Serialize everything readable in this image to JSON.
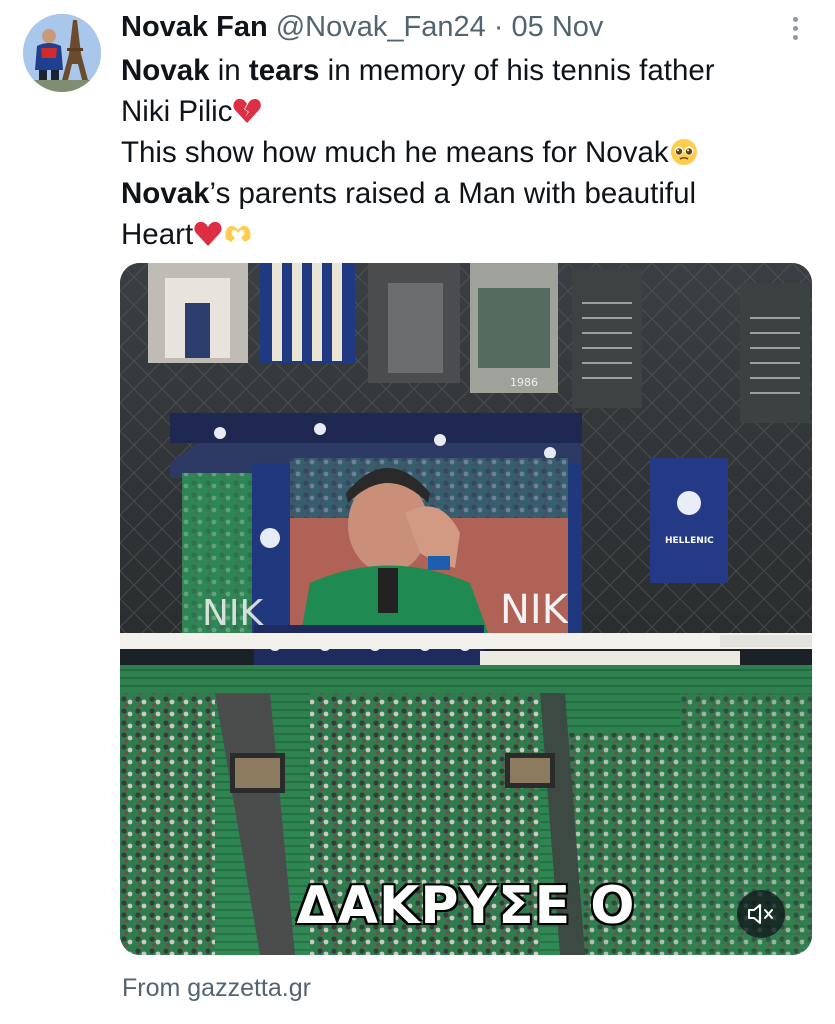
{
  "author": {
    "name": "Novak Fan",
    "handle": "@Novak_Fan24",
    "separator": "·",
    "date": "05 Nov"
  },
  "tweet": {
    "line1_bold1": "Novak",
    "line1_mid": " in ",
    "line1_bold2": "tears",
    "line1_rest": " in memory of his tennis father",
    "line2": "Niki Pilic",
    "line3": "This show how much he means for Novak",
    "line4_bold": "Novak",
    "line4_rest": "’s parents raised a Man with beautiful",
    "line5": "Heart"
  },
  "media": {
    "caption": "ΔΑΚΡΥΣΕ Ο",
    "jumbotron_text_left": "NIK",
    "jumbotron_text_right": "NIK",
    "banner_year": "1986",
    "sponsor": "HELLENIC"
  },
  "icons": {
    "more": "more-options-icon",
    "mute": "muted-speaker-icon",
    "emoji1": "broken-heart-emoji",
    "emoji2": "pleading-face-emoji",
    "emoji3": "red-heart-emoji",
    "emoji4": "heart-hands-emoji"
  },
  "footer": {
    "source": "From gazzetta.gr"
  },
  "colors": {
    "text": "#0f1419",
    "secondary": "#536471",
    "stadium_green": "#2e8a55"
  }
}
